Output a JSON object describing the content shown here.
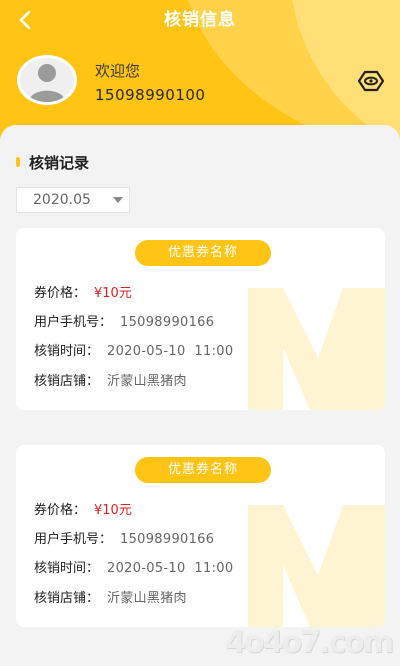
{
  "header": {
    "title": "核销信息",
    "back_icon": "back-arrow-icon"
  },
  "user": {
    "greeting": "欢迎您",
    "phone": "15098990100",
    "avatar_icon": "user-avatar-icon",
    "eye_icon": "eye-icon"
  },
  "section": {
    "title": "核销记录"
  },
  "filter": {
    "selected_month": "2020.05"
  },
  "records": [
    {
      "coupon_name": "优惠券名称",
      "price_label": "券价格：",
      "price": "¥10元",
      "phone_label": "用户手机号：",
      "phone": "15098990166",
      "time_label": "核销时间：",
      "time": "2020-05-10  11:00",
      "store_label": "核销店铺：",
      "store": "沂蒙山黑猪肉"
    },
    {
      "coupon_name": "优惠券名称",
      "price_label": "券价格：",
      "price": "¥10元",
      "phone_label": "用户手机号：",
      "phone": "15098990166",
      "time_label": "核销时间：",
      "time": "2020-05-10  11:00",
      "store_label": "核销店铺：",
      "store": "沂蒙山黑猪肉"
    }
  ],
  "site_mark": "4o4o7.com",
  "colors": {
    "accent": "#ffc414",
    "price": "#e02020",
    "background": "#f3f3f3"
  }
}
